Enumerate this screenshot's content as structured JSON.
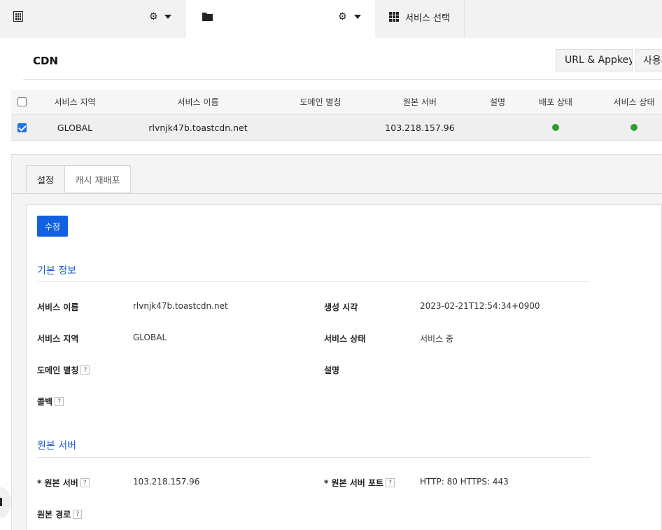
{
  "topbar": {
    "org": {
      "icon": "building-icon",
      "settings_icon": "gear-icon"
    },
    "project": {
      "icon": "folder-icon",
      "settings_icon": "gear-icon"
    },
    "service_select": {
      "icon": "apps-grid-icon",
      "label": "서비스 선택"
    }
  },
  "header": {
    "title": "CDN",
    "buttons": {
      "url_appkey": "URL & Appkey",
      "usage": "사용자"
    }
  },
  "table": {
    "columns": [
      "서비스 지역",
      "서비스 이름",
      "도메인 별칭",
      "원본 서버",
      "설명",
      "배포 상태",
      "서비스 상태"
    ],
    "rows": [
      {
        "checked": true,
        "region": "GLOBAL",
        "name": "rlvnjk47b.toastcdn.net",
        "alias": "",
        "origin": "103.218.157.96",
        "description": "",
        "deploy_status": "green",
        "service_status": "green"
      }
    ]
  },
  "detail": {
    "tabs": [
      "설정",
      "캐시 재배포"
    ],
    "edit_button": "수정",
    "basic": {
      "title": "기본 정보",
      "service_name_label": "서비스 이름",
      "service_name": "rlvnjk47b.toastcdn.net",
      "created_label": "생성 시각",
      "created": "2023-02-21T12:54:34+0900",
      "region_label": "서비스 지역",
      "region": "GLOBAL",
      "status_label": "서비스 상태",
      "status": "서비스 중",
      "alias_label": "도메인 별칭",
      "desc_label": "설명",
      "callback_label": "콜백"
    },
    "origin": {
      "title": "원본 서버",
      "server_label": "* 원본 서버",
      "server": "103.218.157.96",
      "port_label": "* 원본 서버 포트",
      "port": "HTTP: 80 HTTPS: 443",
      "path_label": "원본 경로"
    },
    "help_glyph": "?"
  },
  "colors": {
    "accent": "#1161e0",
    "section_title": "#1f5fcc",
    "status_ok": "#2aa12a"
  }
}
